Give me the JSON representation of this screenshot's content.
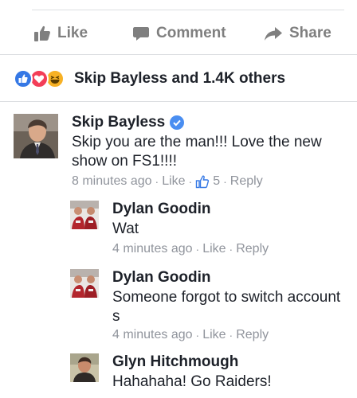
{
  "actions": {
    "like_label": "Like",
    "comment_label": "Comment",
    "share_label": "Share"
  },
  "reactions": {
    "icons": [
      "like-reaction-icon",
      "love-reaction-icon",
      "haha-reaction-icon"
    ],
    "summary": "Skip Bayless and 1.4K others"
  },
  "comments": [
    {
      "author": "Skip Bayless",
      "verified": true,
      "text": "Skip you are the man!!! Love the new show on FS1!!!!",
      "time": "8 minutes ago",
      "like_label": "Like",
      "like_count": "5",
      "reply_label": "Reply"
    },
    {
      "author": "Dylan Goodin",
      "text": "Wat",
      "time": "4 minutes ago",
      "like_label": "Like",
      "reply_label": "Reply"
    },
    {
      "author": "Dylan Goodin",
      "text": "Someone forgot to switch account s",
      "time": "4 minutes ago",
      "like_label": "Like",
      "reply_label": "Reply"
    },
    {
      "author": "Glyn Hitchmough",
      "text": "Hahahaha! Go Raiders!"
    }
  ],
  "colors": {
    "action_gray": "#7f7f7f",
    "meta_gray": "#90949c",
    "like_blue": "#3578e5",
    "love_red": "#f33e58",
    "haha_yellow": "#f7b125",
    "verified_blue": "#4a8ef1"
  }
}
